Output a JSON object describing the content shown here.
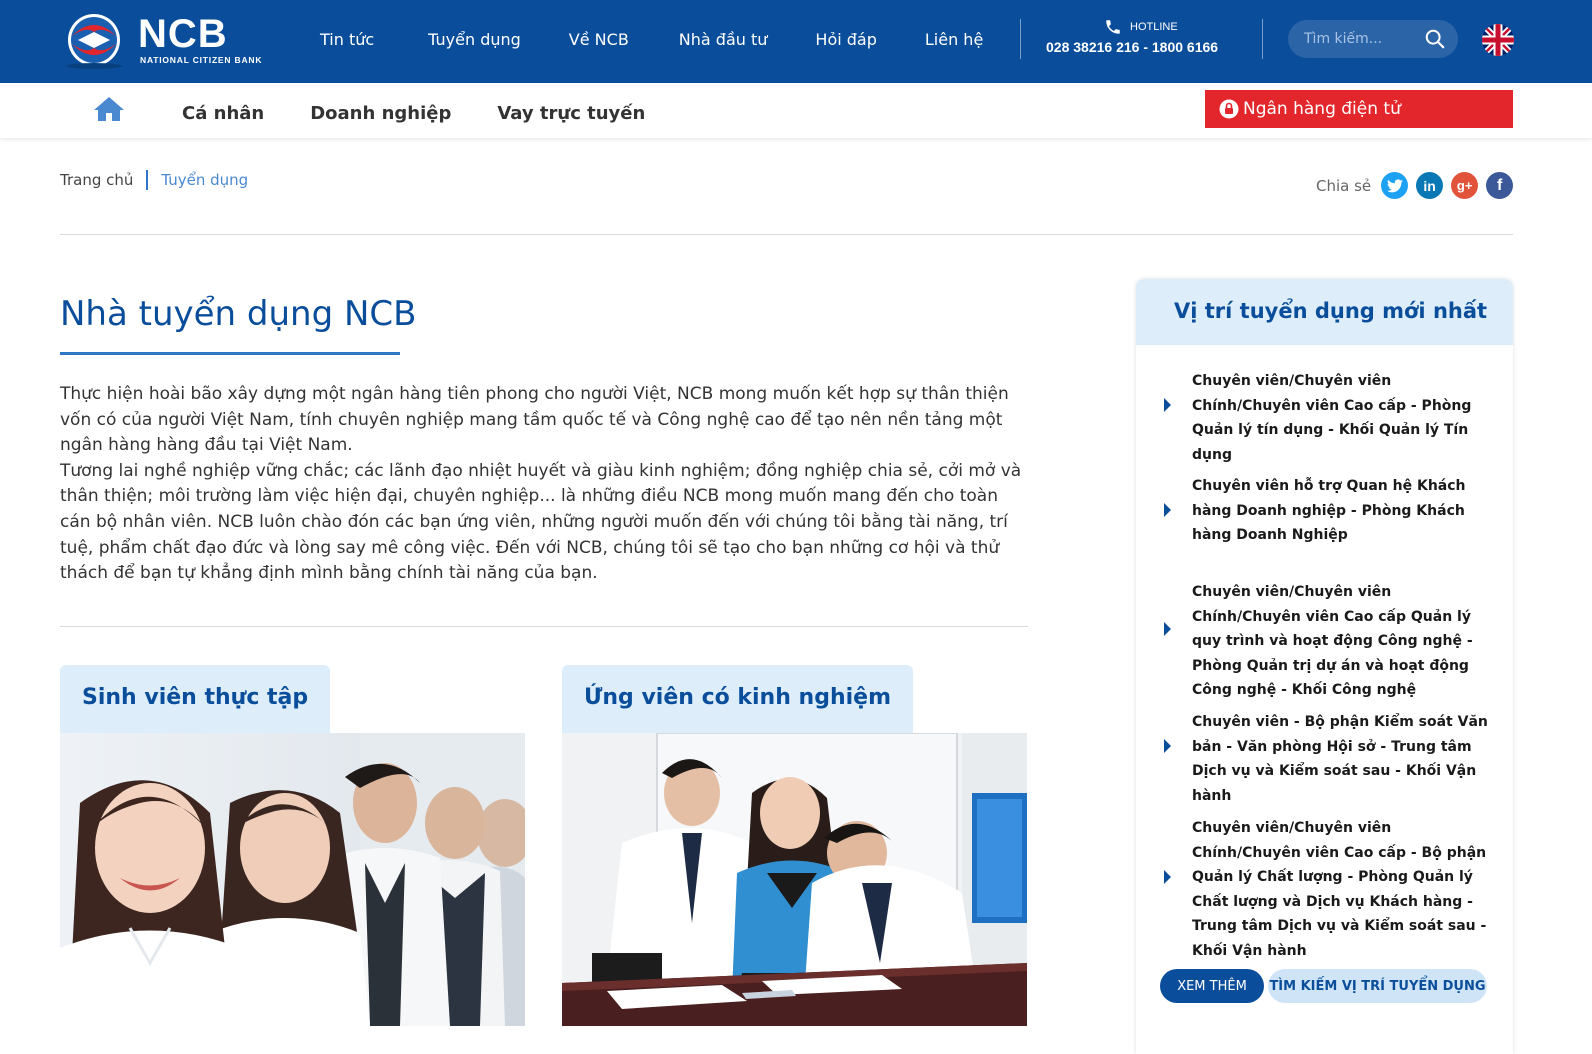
{
  "brand": {
    "name": "NCB",
    "tagline": "NATIONAL CITIZEN BANK",
    "colors": {
      "primary": "#0a4e9b",
      "accent_red": "#e3262b",
      "light_blue": "#ddeefa",
      "link_blue": "#4a89d0"
    }
  },
  "topnav": {
    "items": [
      {
        "label": "Tin tức"
      },
      {
        "label": "Tuyển dụng"
      },
      {
        "label": "Về NCB"
      },
      {
        "label": "Nhà đầu tư"
      },
      {
        "label": "Hỏi đáp"
      },
      {
        "label": "Liên hệ"
      }
    ],
    "hotline_label": "HOTLINE",
    "hotline_number": "028 38216 216 - 1800 6166",
    "search_placeholder": "Tìm kiếm...",
    "language_icon": "uk-flag-icon"
  },
  "subnav": {
    "home_icon": "home-icon",
    "items": [
      {
        "label": "Cá nhân"
      },
      {
        "label": "Doanh nghiệp"
      },
      {
        "label": "Vay trực tuyến"
      }
    ],
    "ebank_label": "Ngân hàng điện tử"
  },
  "breadcrumb": {
    "home": "Trang chủ",
    "current": "Tuyển dụng"
  },
  "share": {
    "label": "Chia sẻ",
    "networks": [
      {
        "name": "twitter-icon",
        "color": "#1da1f2"
      },
      {
        "name": "linkedin-icon",
        "color": "#0a78b5"
      },
      {
        "name": "google-plus-icon",
        "color": "#e2533b"
      },
      {
        "name": "facebook-icon",
        "color": "#3b5998"
      }
    ]
  },
  "main": {
    "title": "Nhà tuyển dụng NCB",
    "intro_p1": "Thực hiện hoài bão xây dựng một ngân hàng tiên phong cho người Việt, NCB mong muốn kết hợp sự thân thiện vốn có của người Việt Nam, tính chuyên nghiệp mang tầm quốc tế và Công nghệ cao để tạo nên nền tảng một ngân hàng hàng đầu tại Việt Nam.",
    "intro_p2": "Tương lai nghề nghiệp vững chắc; các lãnh đạo nhiệt huyết và giàu kinh nghiệm; đồng nghiệp chia sẻ, cởi mở và thân thiện; môi trường làm việc hiện đại, chuyên nghiệp... là những điều NCB mong muốn mang đến cho toàn cán bộ nhân viên. NCB luôn chào đón các bạn ứng viên, những người muốn đến với chúng tôi bằng tài năng, trí tuệ, phẩm chất đạo đức và lòng say mê công việc. Đến với NCB, chúng tôi sẽ tạo cho bạn những cơ hội và thử thách để bạn tự khẳng định mình bằng chính tài năng của bạn.",
    "cards": [
      {
        "title": "Sinh viên thực tập"
      },
      {
        "title": "Ứng viên có kinh nghiệm"
      }
    ]
  },
  "sidebar": {
    "title": "Vị trí tuyển dụng mới nhất",
    "jobs": [
      {
        "title": "Chuyên viên/Chuyên viên Chính/Chuyên viên Cao cấp - Phòng Quản lý tín dụng - Khối Quản lý Tín dụng"
      },
      {
        "title": "Chuyên viên hỗ trợ Quan hệ Khách hàng Doanh nghiệp - Phòng Khách hàng Doanh Nghiệp"
      },
      {
        "title": "Chuyên viên/Chuyên viên Chính/Chuyên viên Cao cấp Quản lý quy trình và hoạt động Công nghệ - Phòng Quản trị dự án và hoạt động Công nghệ - Khối Công nghệ"
      },
      {
        "title": "Chuyên viên - Bộ phận Kiểm soát Văn bản - Văn phòng Hội sở - Trung tâm Dịch vụ và Kiểm soát sau - Khối Vận hành"
      },
      {
        "title": "Chuyên viên/Chuyên viên Chính/Chuyên viên Cao cấp - Bộ phận Quản lý Chất lượng - Phòng Quản lý Chất lượng và Dịch vụ Khách hàng - Trung tâm Dịch vụ và Kiểm soát sau - Khối Vận hành"
      }
    ],
    "more_label": "XEM THÊM",
    "search_label": "TÌM KIẾM VỊ TRÍ TUYỂN DỤNG"
  }
}
